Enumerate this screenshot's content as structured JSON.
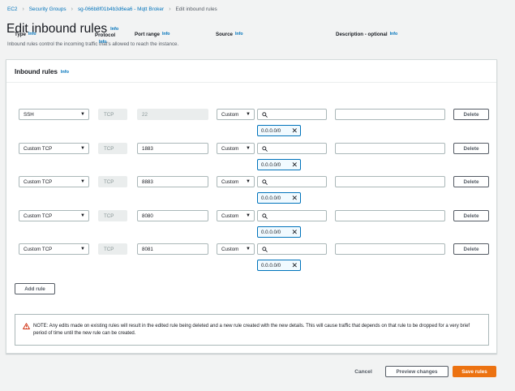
{
  "breadcrumb": {
    "items": [
      "EC2",
      "Security Groups",
      "sg-066b8f01b4b3d6ea6 - Mqtt Broker"
    ],
    "current": "Edit inbound rules",
    "separator": ">"
  },
  "page": {
    "title": "Edit inbound rules",
    "info": "Info",
    "description": "Inbound rules control the incoming traffic that's allowed to reach the instance."
  },
  "panel": {
    "title": "Inbound rules",
    "info": "Info",
    "columns": {
      "type": "Type",
      "type_info": "Info",
      "protocol": "Protocol",
      "protocol_info": "Info",
      "port_range": "Port range",
      "port_info": "Info",
      "source": "Source",
      "source_info": "Info",
      "description": "Description - optional",
      "description_info": "Info"
    }
  },
  "rules": [
    {
      "type": "SSH",
      "protocol": "TCP",
      "port": "22",
      "source_type": "Custom",
      "cidr": "0.0.0.0/0",
      "description": "",
      "delete": "Delete"
    },
    {
      "type": "Custom TCP",
      "protocol": "TCP",
      "port": "1883",
      "source_type": "Custom",
      "cidr": "0.0.0.0/0",
      "description": "",
      "delete": "Delete"
    },
    {
      "type": "Custom TCP",
      "protocol": "TCP",
      "port": "8883",
      "source_type": "Custom",
      "cidr": "0.0.0.0/0",
      "description": "",
      "delete": "Delete"
    },
    {
      "type": "Custom TCP",
      "protocol": "TCP",
      "port": "8080",
      "source_type": "Custom",
      "cidr": "0.0.0.0/0",
      "description": "",
      "delete": "Delete"
    },
    {
      "type": "Custom TCP",
      "protocol": "TCP",
      "port": "8081",
      "source_type": "Custom",
      "cidr": "0.0.0.0/0",
      "description": "",
      "delete": "Delete"
    }
  ],
  "add_rule": "Add rule",
  "notice": "NOTE: Any edits made on existing rules will result in the edited rule being deleted and a new rule created with the new details. This will cause traffic that depends on that rule to be dropped for a very brief period of time until the new rule can be created.",
  "footer": {
    "cancel": "Cancel",
    "preview": "Preview changes",
    "save": "Save rules"
  },
  "colors": {
    "link": "#0073bb",
    "primary": "#ec7211",
    "warning": "#d13212",
    "token_border": "#0073bb"
  },
  "icons": {
    "separator": "chevron-right-icon",
    "dropdown": "caret-down-icon",
    "search": "search-icon",
    "remove": "close-icon",
    "warning": "warning-icon"
  }
}
